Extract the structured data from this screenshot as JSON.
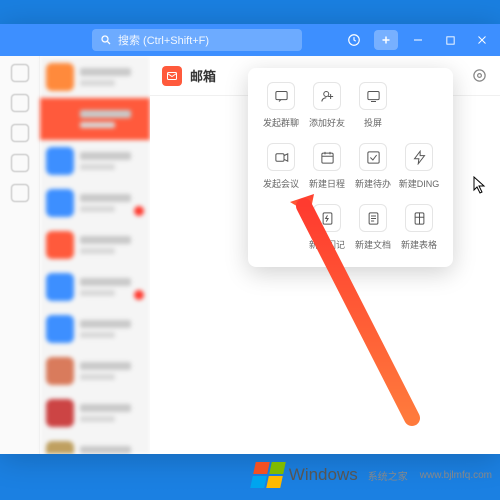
{
  "titlebar": {
    "search_placeholder": "搜索 (Ctrl+Shift+F)"
  },
  "main": {
    "title": "邮箱"
  },
  "popup": {
    "rows": [
      [
        {
          "id": "group-chat",
          "label": "发起群聊",
          "icon": "chat"
        },
        {
          "id": "add-friend",
          "label": "添加好友",
          "icon": "person-add"
        },
        {
          "id": "cast",
          "label": "投屏",
          "icon": "cast"
        }
      ],
      [
        {
          "id": "meeting",
          "label": "发起会议",
          "icon": "video"
        },
        {
          "id": "schedule",
          "label": "新建日程",
          "icon": "calendar"
        },
        {
          "id": "todo",
          "label": "新建待办",
          "icon": "check"
        },
        {
          "id": "ding",
          "label": "新建DING",
          "icon": "bolt"
        }
      ],
      [
        {
          "id": "flash-note",
          "label": "新建闪记",
          "icon": "flash-doc"
        },
        {
          "id": "doc",
          "label": "新建文档",
          "icon": "doc"
        },
        {
          "id": "sheet",
          "label": "新建表格",
          "icon": "sheet"
        }
      ]
    ]
  },
  "sidebar": {
    "items": [
      {
        "color": "#ff8a3c",
        "badge": false
      },
      {
        "color": "#ff5a3c",
        "badge": false,
        "selected": true
      },
      {
        "color": "#3d8fff",
        "badge": false
      },
      {
        "color": "#3d8fff",
        "badge": true
      },
      {
        "color": "#ff5a3c",
        "badge": false
      },
      {
        "color": "#3d8fff",
        "badge": true
      },
      {
        "color": "#3d8fff",
        "badge": false
      },
      {
        "color": "#d97b5c",
        "badge": false
      },
      {
        "color": "#c44",
        "badge": false
      },
      {
        "color": "#bfa060",
        "badge": false
      }
    ]
  },
  "watermark": {
    "main": "Windows",
    "sub": "系统之家",
    "url": "www.bjlmfq.com"
  }
}
